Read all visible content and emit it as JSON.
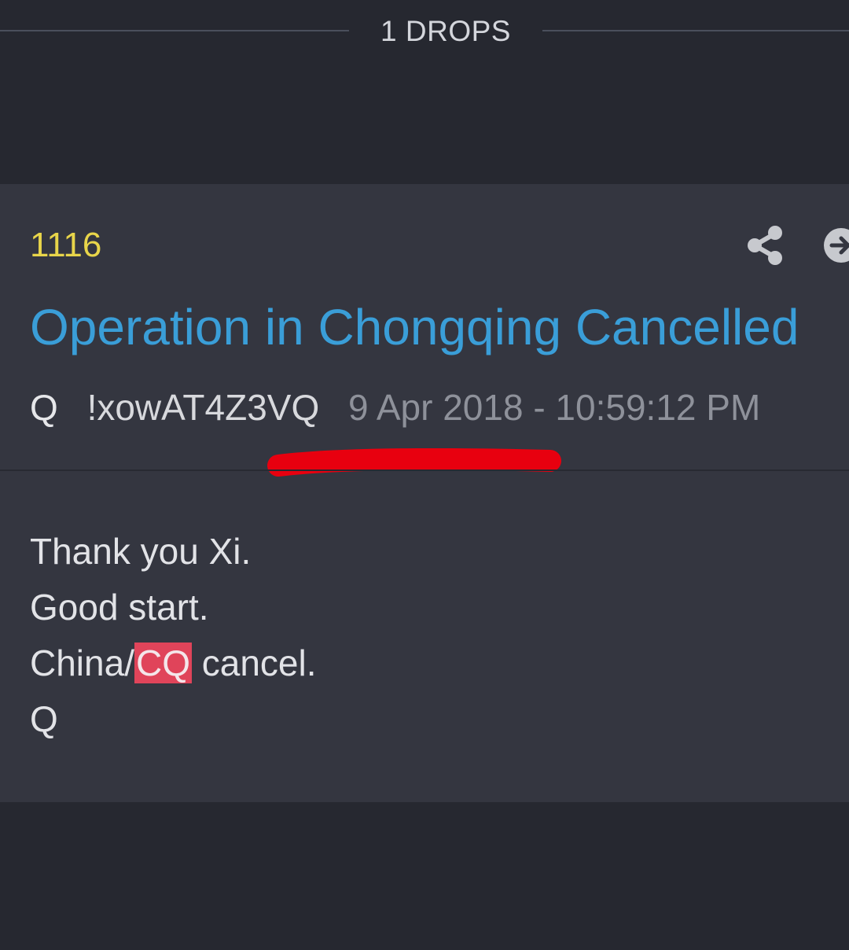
{
  "header": {
    "title": "1 DROPS"
  },
  "drop": {
    "number": "1116",
    "title": "Operation in Chongqing Cancelled",
    "author": "Q",
    "tripcode": "!xowAT4Z3VQ",
    "timestamp": "9 Apr 2018 - 10:59:12 PM",
    "body": {
      "line1": "Thank you Xi.",
      "line2": "Good start.",
      "line3_prefix": "China/",
      "line3_highlight": "CQ",
      "line3_suffix": " cancel.",
      "line4": "Q"
    }
  },
  "icons": {
    "share": "share-icon",
    "goto": "arrow-circle-right-icon"
  },
  "colors": {
    "number": "#e8d54a",
    "title": "#3a9ed8",
    "highlight": "#e0445a",
    "annotation": "#e8000f"
  }
}
